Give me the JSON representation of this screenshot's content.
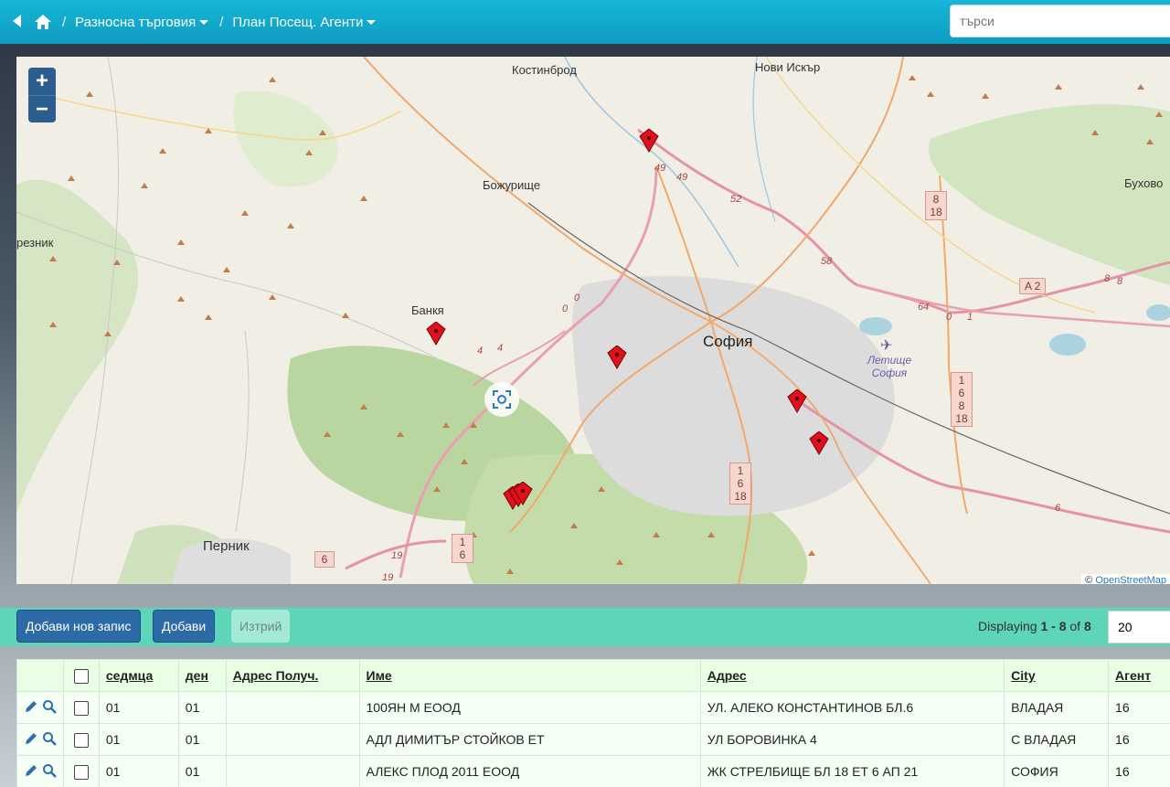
{
  "header": {
    "breadcrumbs": [
      {
        "label": "Разносна търговия"
      },
      {
        "label": "План Посещ. Агенти"
      }
    ],
    "search_placeholder": "търси"
  },
  "map": {
    "places": [
      {
        "name": "Костинброд"
      },
      {
        "name": "Нови Искър"
      },
      {
        "name": "Божурище"
      },
      {
        "name": "Банкя"
      },
      {
        "name": "София"
      },
      {
        "name": "Летище София"
      },
      {
        "name": "Перник"
      },
      {
        "name": "Бухово"
      },
      {
        "name": "резник"
      }
    ],
    "road_labels": [
      "49",
      "49",
      "52",
      "58",
      "64",
      "0",
      "4",
      "4",
      "0",
      "19",
      "19",
      "6",
      "A 2",
      "0",
      "1",
      "8",
      "8"
    ],
    "road_shields": [
      "8 18",
      "1 6 8 18",
      "1 6 18",
      "1 6",
      "6"
    ],
    "markers_count": 8,
    "zoom_in": "+",
    "zoom_out": "−",
    "attribution_prefix": "©",
    "attribution_link": "OpenStreetMap"
  },
  "toolbar": {
    "add_new": "Добави нов запис",
    "add": "Добави",
    "delete": "Изтрий",
    "displaying_prefix": "Displaying",
    "displaying_range": "1 - 8",
    "displaying_of": "of",
    "displaying_total": "8",
    "page_size": "20"
  },
  "table": {
    "columns": [
      "седмца",
      "ден",
      "Адрес Получ.",
      "Име",
      "Адрес",
      "City",
      "Агент"
    ],
    "rows": [
      {
        "week": "01",
        "day": "01",
        "recv": "",
        "name": "100ЯН М ЕООД",
        "address": "УЛ. АЛЕКО КОНСТАНТИНОВ БЛ.6",
        "city": "ВЛАДАЯ",
        "agent": "16"
      },
      {
        "week": "01",
        "day": "01",
        "recv": "",
        "name": "АДЛ ДИМИТЪР СТОЙКОВ ЕТ",
        "address": "УЛ БОРОВИНКА 4",
        "city": "С ВЛАДАЯ",
        "agent": "16"
      },
      {
        "week": "01",
        "day": "01",
        "recv": "",
        "name": "АЛЕКС ПЛОД 2011 ЕООД",
        "address": "ЖК СТРЕЛБИЩЕ БЛ 18 ЕТ 6 АП 21",
        "city": "СОФИЯ",
        "agent": "16"
      }
    ]
  }
}
